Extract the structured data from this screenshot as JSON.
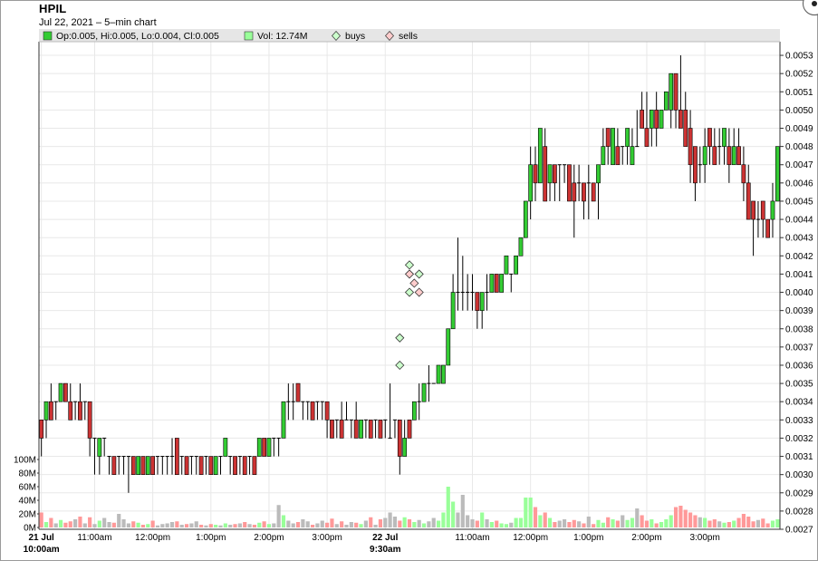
{
  "header": {
    "symbol": "HPIL",
    "subtitle": "Jul 22, 2021  – 5–min chart"
  },
  "legend": {
    "ohlc_text": "Op:0.005, Hi:0.005, Lo:0.004, Cl:0.005",
    "volume_text": "Vol: 12.74M",
    "buys_text": "buys",
    "sells_text": "sells"
  },
  "colors": {
    "up": "#33cc33",
    "down": "#cc3333",
    "vol_up": "#99ff99",
    "vol_down": "#ff9999",
    "vol_neutral": "#bbbbbb",
    "grid": "#e8e8e8",
    "legend_bg": "#e6e6e6",
    "buy_marker": "#ccffcc",
    "sell_marker": "#ffcccc"
  },
  "chart_data": {
    "type": "candlestick",
    "y_ticks": [
      "0.0027",
      "0.0028",
      "0.0029",
      "0.0030",
      "0.0031",
      "0.0032",
      "0.0033",
      "0.0034",
      "0.0035",
      "0.0036",
      "0.0037",
      "0.0038",
      "0.0039",
      "0.0040",
      "0.0041",
      "0.0042",
      "0.0043",
      "0.0044",
      "0.0045",
      "0.0046",
      "0.0047",
      "0.0048",
      "0.0049",
      "0.0050",
      "0.0051",
      "0.0052",
      "0.0053"
    ],
    "ylim": [
      0.0027,
      0.00535
    ],
    "volume_ticks": [
      "0M",
      "20M",
      "40M",
      "60M",
      "80M",
      "100M"
    ],
    "volume_max": 100,
    "x_ticks": [
      {
        "label": "21 Jul",
        "sub": "10:00am",
        "bold": true,
        "index": 0
      },
      {
        "label": "11:00am",
        "sub": "",
        "bold": false,
        "index": 11
      },
      {
        "label": "12:00pm",
        "sub": "",
        "bold": false,
        "index": 23
      },
      {
        "label": "1:00pm",
        "sub": "",
        "bold": false,
        "index": 35
      },
      {
        "label": "2:00pm",
        "sub": "",
        "bold": false,
        "index": 47
      },
      {
        "label": "3:00pm",
        "sub": "",
        "bold": false,
        "index": 59
      },
      {
        "label": "22 Jul",
        "sub": "9:30am",
        "bold": true,
        "index": 71
      },
      {
        "label": "11:00am",
        "sub": "",
        "bold": false,
        "index": 89
      },
      {
        "label": "12:00pm",
        "sub": "",
        "bold": false,
        "index": 101
      },
      {
        "label": "1:00pm",
        "sub": "",
        "bold": false,
        "index": 113
      },
      {
        "label": "2:00pm",
        "sub": "",
        "bold": false,
        "index": 125
      },
      {
        "label": "3:00pm",
        "sub": "",
        "bold": false,
        "index": 137
      }
    ],
    "candles": [
      [
        0.0033,
        0.0033,
        0.0031,
        0.0032,
        22
      ],
      [
        0.0033,
        0.0034,
        0.0032,
        0.0034,
        8
      ],
      [
        0.0034,
        0.0035,
        0.0033,
        0.0033,
        14
      ],
      [
        0.0034,
        0.0034,
        0.0033,
        0.0034,
        6
      ],
      [
        0.0034,
        0.0035,
        0.0034,
        0.0035,
        11
      ],
      [
        0.0035,
        0.0035,
        0.0034,
        0.0034,
        7
      ],
      [
        0.0034,
        0.0035,
        0.0033,
        0.0033,
        9
      ],
      [
        0.0034,
        0.0034,
        0.0033,
        0.0034,
        12
      ],
      [
        0.0034,
        0.0035,
        0.0033,
        0.0033,
        16
      ],
      [
        0.0034,
        0.0034,
        0.0033,
        0.0034,
        6
      ],
      [
        0.0034,
        0.0034,
        0.0031,
        0.0032,
        15
      ],
      [
        0.0032,
        0.0032,
        0.003,
        0.0032,
        5
      ],
      [
        0.0031,
        0.0032,
        0.003,
        0.0032,
        10
      ],
      [
        0.0032,
        0.0032,
        0.0031,
        0.0032,
        14
      ],
      [
        0.0031,
        0.0031,
        0.003,
        0.0031,
        8
      ],
      [
        0.0031,
        0.0031,
        0.003,
        0.003,
        7
      ],
      [
        0.0031,
        0.0031,
        0.003,
        0.0031,
        20
      ],
      [
        0.0031,
        0.0031,
        0.003,
        0.0031,
        12
      ],
      [
        0.0031,
        0.0031,
        0.0029,
        0.0031,
        6
      ],
      [
        0.0031,
        0.0031,
        0.003,
        0.003,
        9
      ],
      [
        0.003,
        0.0031,
        0.003,
        0.0031,
        7
      ],
      [
        0.0031,
        0.0031,
        0.003,
        0.003,
        4
      ],
      [
        0.003,
        0.0031,
        0.003,
        0.0031,
        5
      ],
      [
        0.0031,
        0.0031,
        0.003,
        0.003,
        10
      ],
      [
        0.0031,
        0.0031,
        0.003,
        0.0031,
        3
      ],
      [
        0.0031,
        0.0031,
        0.003,
        0.0031,
        5
      ],
      [
        0.0031,
        0.0031,
        0.003,
        0.0031,
        6
      ],
      [
        0.0031,
        0.0032,
        0.003,
        0.0031,
        8
      ],
      [
        0.0032,
        0.0032,
        0.003,
        0.003,
        9
      ],
      [
        0.0031,
        0.0031,
        0.003,
        0.0031,
        4
      ],
      [
        0.0031,
        0.0031,
        0.003,
        0.003,
        5
      ],
      [
        0.0031,
        0.0031,
        0.003,
        0.0031,
        6
      ],
      [
        0.0031,
        0.0031,
        0.003,
        0.0031,
        9
      ],
      [
        0.0031,
        0.0031,
        0.003,
        0.003,
        4
      ],
      [
        0.0031,
        0.0031,
        0.003,
        0.0031,
        3
      ],
      [
        0.0031,
        0.0031,
        0.003,
        0.003,
        5
      ],
      [
        0.003,
        0.0031,
        0.003,
        0.0031,
        4
      ],
      [
        0.0031,
        0.0031,
        0.003,
        0.0031,
        3
      ],
      [
        0.0031,
        0.0032,
        0.0031,
        0.0032,
        6
      ],
      [
        0.0031,
        0.0031,
        0.003,
        0.0031,
        4
      ],
      [
        0.0031,
        0.0031,
        0.003,
        0.003,
        5
      ],
      [
        0.0031,
        0.0031,
        0.003,
        0.0031,
        6
      ],
      [
        0.0031,
        0.0031,
        0.003,
        0.003,
        8
      ],
      [
        0.0031,
        0.0031,
        0.003,
        0.0031,
        5
      ],
      [
        0.0031,
        0.0031,
        0.003,
        0.003,
        4
      ],
      [
        0.0031,
        0.0032,
        0.0031,
        0.0032,
        7
      ],
      [
        0.0032,
        0.0032,
        0.0031,
        0.0031,
        9
      ],
      [
        0.0031,
        0.0032,
        0.0031,
        0.0032,
        5
      ],
      [
        0.0032,
        0.0032,
        0.0031,
        0.0032,
        6
      ],
      [
        0.0032,
        0.0032,
        0.0031,
        0.0032,
        33
      ],
      [
        0.0032,
        0.0034,
        0.0032,
        0.0034,
        18
      ],
      [
        0.0034,
        0.0035,
        0.0033,
        0.0034,
        10
      ],
      [
        0.0034,
        0.0035,
        0.0033,
        0.0034,
        6
      ],
      [
        0.0035,
        0.0035,
        0.0034,
        0.0034,
        8
      ],
      [
        0.0034,
        0.0034,
        0.0033,
        0.0034,
        12
      ],
      [
        0.0034,
        0.0034,
        0.0033,
        0.0034,
        9
      ],
      [
        0.0034,
        0.0034,
        0.0033,
        0.0033,
        4
      ],
      [
        0.0034,
        0.0034,
        0.0033,
        0.0034,
        6
      ],
      [
        0.0034,
        0.0034,
        0.0033,
        0.0034,
        10
      ],
      [
        0.0034,
        0.0034,
        0.0032,
        0.0033,
        7
      ],
      [
        0.0033,
        0.0033,
        0.0032,
        0.0032,
        13
      ],
      [
        0.0033,
        0.0033,
        0.0032,
        0.0033,
        5
      ],
      [
        0.0033,
        0.0034,
        0.0032,
        0.0032,
        9
      ],
      [
        0.0033,
        0.0034,
        0.0033,
        0.0033,
        4
      ],
      [
        0.0033,
        0.0033,
        0.0032,
        0.0033,
        8
      ],
      [
        0.0033,
        0.0034,
        0.0032,
        0.0032,
        7
      ],
      [
        0.0032,
        0.0033,
        0.0032,
        0.0033,
        5
      ],
      [
        0.0033,
        0.0033,
        0.0032,
        0.0033,
        10
      ],
      [
        0.0033,
        0.0033,
        0.0032,
        0.0032,
        15
      ],
      [
        0.0033,
        0.0033,
        0.0032,
        0.0033,
        4
      ],
      [
        0.0033,
        0.0033,
        0.0032,
        0.0032,
        12
      ],
      [
        0.0033,
        0.0033,
        0.0032,
        0.0033,
        14
      ],
      [
        0.0032,
        0.0035,
        0.0032,
        0.0032,
        22
      ],
      [
        0.0033,
        0.0033,
        0.0032,
        0.0033,
        16
      ],
      [
        0.0033,
        0.0033,
        0.003,
        0.0031,
        10
      ],
      [
        0.0031,
        0.0033,
        0.0031,
        0.0032,
        15
      ],
      [
        0.0033,
        0.0033,
        0.0032,
        0.0032,
        12
      ],
      [
        0.0033,
        0.0034,
        0.0033,
        0.0034,
        8
      ],
      [
        0.0034,
        0.0035,
        0.0033,
        0.0034,
        11
      ],
      [
        0.0034,
        0.0035,
        0.0034,
        0.0035,
        6
      ],
      [
        0.0035,
        0.0036,
        0.0034,
        0.0035,
        9
      ],
      [
        0.0035,
        0.0035,
        0.0035,
        0.0035,
        14
      ],
      [
        0.0035,
        0.0036,
        0.0035,
        0.0036,
        10
      ],
      [
        0.0035,
        0.0036,
        0.0035,
        0.0036,
        22
      ],
      [
        0.0036,
        0.0038,
        0.0036,
        0.0038,
        60
      ],
      [
        0.0038,
        0.0041,
        0.0038,
        0.004,
        38
      ],
      [
        0.004,
        0.0043,
        0.0039,
        0.004,
        22
      ],
      [
        0.004,
        0.0042,
        0.0039,
        0.004,
        48
      ],
      [
        0.004,
        0.0041,
        0.0039,
        0.004,
        18
      ],
      [
        0.004,
        0.0041,
        0.0039,
        0.004,
        12
      ],
      [
        0.004,
        0.004,
        0.0038,
        0.0039,
        10
      ],
      [
        0.0039,
        0.004,
        0.0038,
        0.004,
        22
      ],
      [
        0.004,
        0.0041,
        0.0039,
        0.004,
        12
      ],
      [
        0.004,
        0.0041,
        0.004,
        0.0041,
        8
      ],
      [
        0.0041,
        0.0041,
        0.004,
        0.004,
        10
      ],
      [
        0.004,
        0.0041,
        0.004,
        0.0041,
        6
      ],
      [
        0.0041,
        0.0042,
        0.0041,
        0.0042,
        5
      ],
      [
        0.0041,
        0.0041,
        0.004,
        0.0041,
        7
      ],
      [
        0.0041,
        0.0042,
        0.0041,
        0.0042,
        14
      ],
      [
        0.0042,
        0.0043,
        0.0042,
        0.0043,
        14
      ],
      [
        0.0043,
        0.0045,
        0.0043,
        0.0045,
        44
      ],
      [
        0.0045,
        0.0048,
        0.0044,
        0.0047,
        44
      ],
      [
        0.0047,
        0.0048,
        0.0045,
        0.0046,
        30
      ],
      [
        0.0046,
        0.0049,
        0.0046,
        0.0049,
        18
      ],
      [
        0.0048,
        0.0049,
        0.0045,
        0.0045,
        22
      ],
      [
        0.0046,
        0.0047,
        0.0045,
        0.0047,
        14
      ],
      [
        0.0047,
        0.0047,
        0.0045,
        0.0046,
        8
      ],
      [
        0.0047,
        0.0047,
        0.0045,
        0.0047,
        10
      ],
      [
        0.0047,
        0.0047,
        0.0046,
        0.0047,
        12
      ],
      [
        0.0047,
        0.0047,
        0.0045,
        0.0045,
        8
      ],
      [
        0.0046,
        0.0047,
        0.0043,
        0.0045,
        11
      ],
      [
        0.0046,
        0.0047,
        0.0045,
        0.0046,
        9
      ],
      [
        0.0046,
        0.0046,
        0.0044,
        0.0045,
        6
      ],
      [
        0.0046,
        0.0047,
        0.0044,
        0.0046,
        16
      ],
      [
        0.0046,
        0.0046,
        0.0045,
        0.0045,
        5
      ],
      [
        0.0046,
        0.0047,
        0.0044,
        0.0047,
        11
      ],
      [
        0.0047,
        0.0049,
        0.0047,
        0.0048,
        7
      ],
      [
        0.0049,
        0.0049,
        0.0047,
        0.0048,
        15
      ],
      [
        0.0047,
        0.0049,
        0.0047,
        0.0049,
        12
      ],
      [
        0.0048,
        0.0049,
        0.0047,
        0.0047,
        10
      ],
      [
        0.0048,
        0.0048,
        0.0047,
        0.0048,
        18
      ],
      [
        0.0048,
        0.0049,
        0.0047,
        0.0049,
        11
      ],
      [
        0.0047,
        0.0049,
        0.0047,
        0.0048,
        14
      ],
      [
        0.0048,
        0.005,
        0.0048,
        0.0048,
        28
      ],
      [
        0.005,
        0.0051,
        0.0049,
        0.0049,
        18
      ],
      [
        0.0049,
        0.0051,
        0.0048,
        0.0048,
        10
      ],
      [
        0.0049,
        0.005,
        0.0048,
        0.005,
        12
      ],
      [
        0.005,
        0.0051,
        0.0048,
        0.0049,
        6
      ],
      [
        0.0049,
        0.005,
        0.0049,
        0.005,
        8
      ],
      [
        0.005,
        0.0051,
        0.005,
        0.0051,
        12
      ],
      [
        0.005,
        0.0052,
        0.0049,
        0.0052,
        18
      ],
      [
        0.0052,
        0.0052,
        0.0049,
        0.005,
        30
      ],
      [
        0.005,
        0.0053,
        0.0049,
        0.0049,
        32
      ],
      [
        0.005,
        0.0051,
        0.0048,
        0.0048,
        26
      ],
      [
        0.0049,
        0.005,
        0.0046,
        0.0047,
        22
      ],
      [
        0.0048,
        0.0048,
        0.0045,
        0.0046,
        18
      ],
      [
        0.0047,
        0.0048,
        0.0046,
        0.0047,
        15
      ],
      [
        0.0047,
        0.0049,
        0.0046,
        0.0048,
        14
      ],
      [
        0.0049,
        0.0049,
        0.0047,
        0.0048,
        10
      ],
      [
        0.0048,
        0.0049,
        0.0047,
        0.0047,
        12
      ],
      [
        0.0048,
        0.0049,
        0.0047,
        0.0048,
        9
      ],
      [
        0.0048,
        0.0049,
        0.0047,
        0.0049,
        7
      ],
      [
        0.0048,
        0.0049,
        0.0046,
        0.0047,
        8
      ],
      [
        0.0047,
        0.0049,
        0.0047,
        0.0048,
        10
      ],
      [
        0.0048,
        0.0049,
        0.0047,
        0.0047,
        14
      ],
      [
        0.0047,
        0.0048,
        0.0045,
        0.0046,
        20
      ],
      [
        0.0046,
        0.0047,
        0.0044,
        0.0044,
        16
      ],
      [
        0.0045,
        0.0045,
        0.0042,
        0.0044,
        9
      ],
      [
        0.0044,
        0.0045,
        0.0043,
        0.0044,
        11
      ],
      [
        0.0045,
        0.0045,
        0.0043,
        0.0044,
        13
      ],
      [
        0.0044,
        0.0044,
        0.0043,
        0.0043,
        6
      ],
      [
        0.0044,
        0.0046,
        0.0043,
        0.0045,
        10
      ],
      [
        0.0045,
        0.0048,
        0.0045,
        0.0048,
        12
      ]
    ],
    "markers": [
      {
        "index": 74,
        "price": 0.0036,
        "kind": "buy"
      },
      {
        "index": 74,
        "price": 0.00375,
        "kind": "buy"
      },
      {
        "index": 76,
        "price": 0.00415,
        "kind": "buy"
      },
      {
        "index": 76,
        "price": 0.0041,
        "kind": "sell"
      },
      {
        "index": 76,
        "price": 0.004,
        "kind": "buy"
      },
      {
        "index": 77,
        "price": 0.00405,
        "kind": "sell"
      },
      {
        "index": 78,
        "price": 0.0041,
        "kind": "buy"
      },
      {
        "index": 78,
        "price": 0.004,
        "kind": "sell"
      }
    ]
  }
}
